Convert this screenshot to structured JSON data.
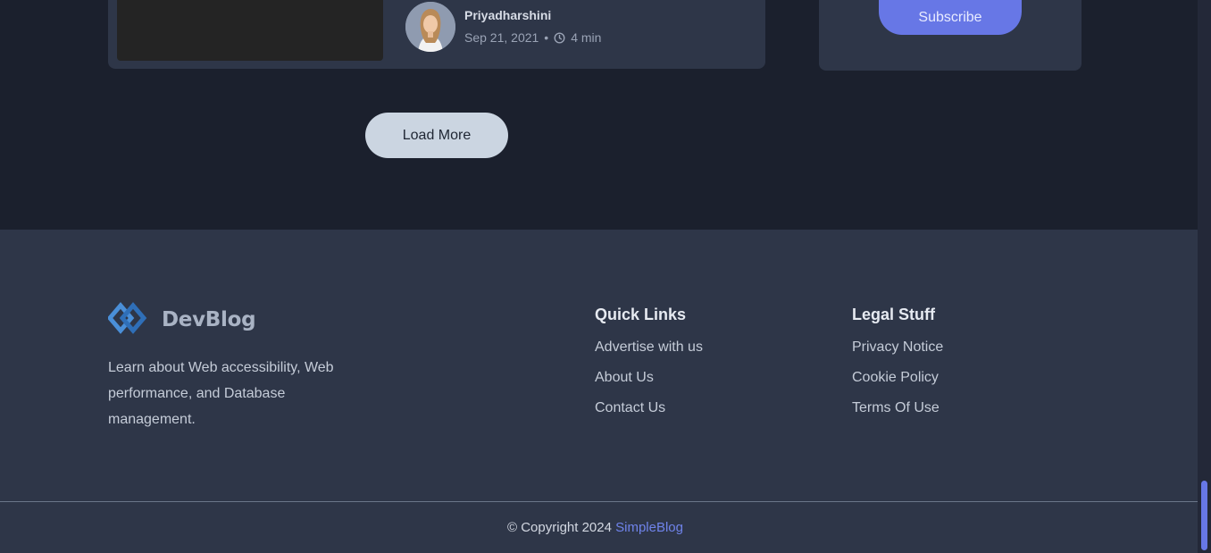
{
  "post": {
    "author": "Priyadharshini",
    "date": "Sep 21, 2021",
    "separator": "•",
    "read_time": "4 min"
  },
  "sidebar": {
    "subscribe_label": "Subscribe"
  },
  "load_more_label": "Load More",
  "footer": {
    "brand": "DevBlog",
    "description": "Learn about Web accessibility, Web performance, and Database management.",
    "quick_links": {
      "title": "Quick Links",
      "items": [
        "Advertise with us",
        "About Us",
        "Contact Us"
      ]
    },
    "legal": {
      "title": "Legal Stuff",
      "items": [
        "Privacy Notice",
        "Cookie Policy",
        "Terms Of Use"
      ]
    },
    "copyright_text": "© Copyright 2024",
    "copyright_link": "SimpleBlog"
  },
  "colors": {
    "accent": "#6777e6",
    "footer_bg": "#2e3648",
    "page_bg": "#1b202d"
  },
  "icons": [
    "clock-icon",
    "devblog-logo-icon",
    "avatar"
  ]
}
